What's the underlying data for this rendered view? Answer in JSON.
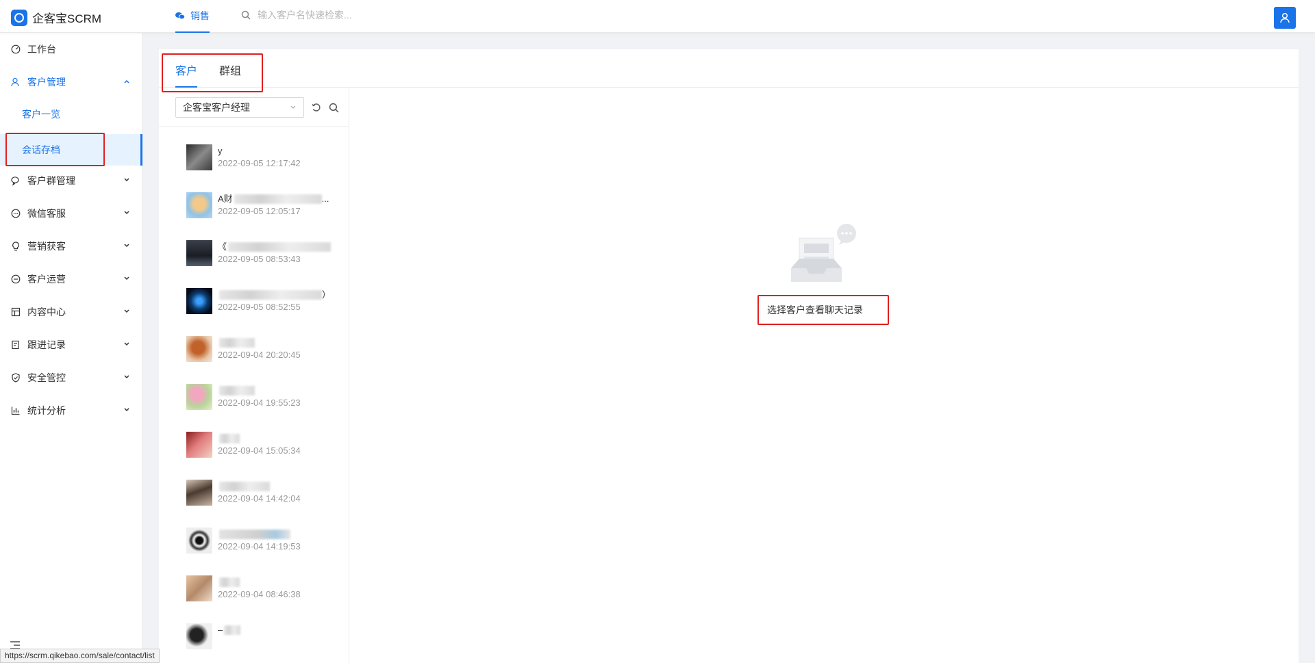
{
  "header": {
    "app_name": "企客宝SCRM",
    "top_tab": "销售",
    "search_placeholder": "输入客户名快速检索..."
  },
  "sidebar": {
    "items": [
      {
        "label": "工作台",
        "icon": "dashboard-icon"
      },
      {
        "label": "客户管理",
        "icon": "customer-icon",
        "expanded": true
      },
      {
        "label": "客户群管理",
        "icon": "group-chat-icon"
      },
      {
        "label": "微信客服",
        "icon": "service-icon"
      },
      {
        "label": "营销获客",
        "icon": "bulb-icon"
      },
      {
        "label": "客户运营",
        "icon": "operation-icon"
      },
      {
        "label": "内容中心",
        "icon": "content-icon"
      },
      {
        "label": "跟进记录",
        "icon": "record-icon"
      },
      {
        "label": "安全管控",
        "icon": "shield-icon"
      },
      {
        "label": "统计分析",
        "icon": "chart-icon"
      }
    ],
    "subitems": [
      {
        "label": "客户一览"
      },
      {
        "label": "会话存档",
        "active": true
      }
    ]
  },
  "main": {
    "tabs": [
      {
        "label": "客户",
        "active": true
      },
      {
        "label": "群组"
      }
    ],
    "filter": {
      "selected": "企客宝客户经理"
    },
    "contacts": [
      {
        "name": "y",
        "time": "2022-09-05 12:17:42"
      },
      {
        "name": "A财",
        "name_tail": "...",
        "time": "2022-09-05 12:05:17"
      },
      {
        "name": "《",
        "time": "2022-09-05 08:53:43"
      },
      {
        "name": "",
        "name_tail": "）",
        "time": "2022-09-05 08:52:55"
      },
      {
        "name": "",
        "time": "2022-09-04 20:20:45"
      },
      {
        "name": "",
        "time": "2022-09-04 19:55:23"
      },
      {
        "name": "",
        "time": "2022-09-04 15:05:34"
      },
      {
        "name": "",
        "time": "2022-09-04 14:42:04"
      },
      {
        "name": "",
        "time": "2022-09-04 14:19:53"
      },
      {
        "name": "",
        "time": "2022-09-04 08:46:38"
      },
      {
        "name": "–",
        "time": ""
      }
    ],
    "empty_text": "选择客户查看聊天记录"
  },
  "status_url": "https://scrm.qikebao.com/sale/contact/list",
  "colors": {
    "accent": "#1a73e8",
    "highlight": "#e02020",
    "active_bg": "#e6f3ff"
  }
}
